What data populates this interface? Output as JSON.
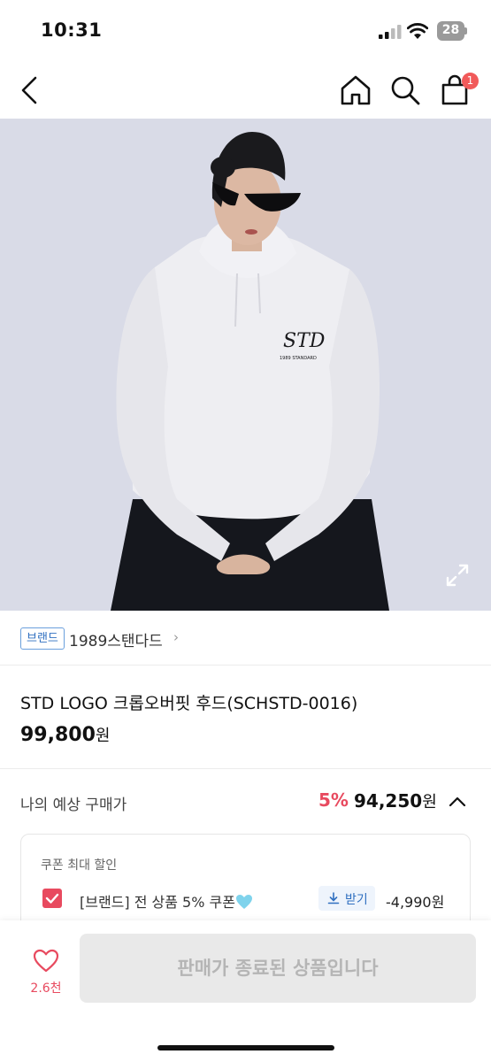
{
  "status_bar": {
    "time": "10:31",
    "battery": "28",
    "icons": [
      "signal-icon",
      "wifi-icon",
      "battery-icon"
    ]
  },
  "nav": {
    "icons": [
      "back-icon",
      "home-icon",
      "search-icon",
      "shopping-bag-icon"
    ],
    "cart_badge": "1"
  },
  "hero": {
    "logo_text": "STD",
    "logo_sub": "1989 STANDARD",
    "icons": [
      "expand-icon"
    ]
  },
  "brand": {
    "badge": "브랜드",
    "name": "1989스탠다드",
    "chevron": "›"
  },
  "product": {
    "title": "STD LOGO 크롭오버핏 후드(SCHSTD-0016)",
    "price": "99,800",
    "currency": "원"
  },
  "expected": {
    "label": "나의 예상 구매가",
    "rate": "5%",
    "price": "94,250",
    "currency": "원"
  },
  "coupon": {
    "heading": "쿠폰 최대 할인",
    "name": "[브랜드] 전 상품 5% 쿠폰",
    "button": "받기",
    "amount": "-4,990원"
  },
  "bottom": {
    "like_count": "2.6천",
    "buy_label": "판매가 종료된 상품입니다"
  },
  "colors": {
    "accent_red": "#e84a5f",
    "brand_blue": "#2f6fc0",
    "hero_bg": "#d9dbe7"
  }
}
